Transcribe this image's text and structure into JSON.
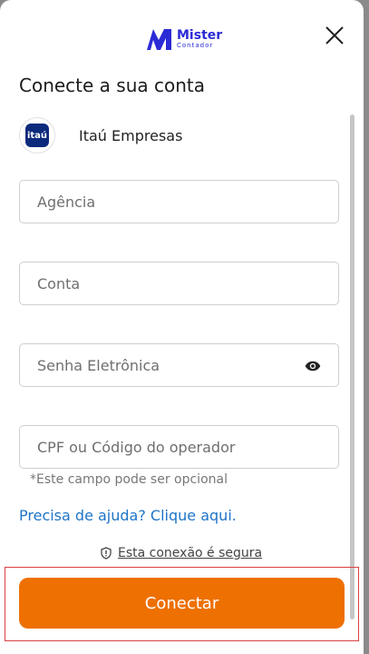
{
  "brand": {
    "name": "Mister",
    "subtitle": "Contador",
    "color": "#2b2bd6"
  },
  "dialog": {
    "title": "Conecte a sua conta",
    "close_icon": "close-icon"
  },
  "bank": {
    "logo_text": "itaú",
    "name": "Itaú Empresas",
    "logo_color": "#0b2a7c"
  },
  "form": {
    "agencia_placeholder": "Agência",
    "conta_placeholder": "Conta",
    "senha_placeholder": "Senha Eletrônica",
    "cpf_placeholder": "CPF ou Código do operador",
    "cpf_hint": "*Este campo pode ser opcional"
  },
  "help_link": "Precisa de ajuda? Clique aqui.",
  "secure_text": "Esta conexão é segura",
  "connect_button": {
    "label": "Conectar",
    "color": "#ee7000"
  }
}
